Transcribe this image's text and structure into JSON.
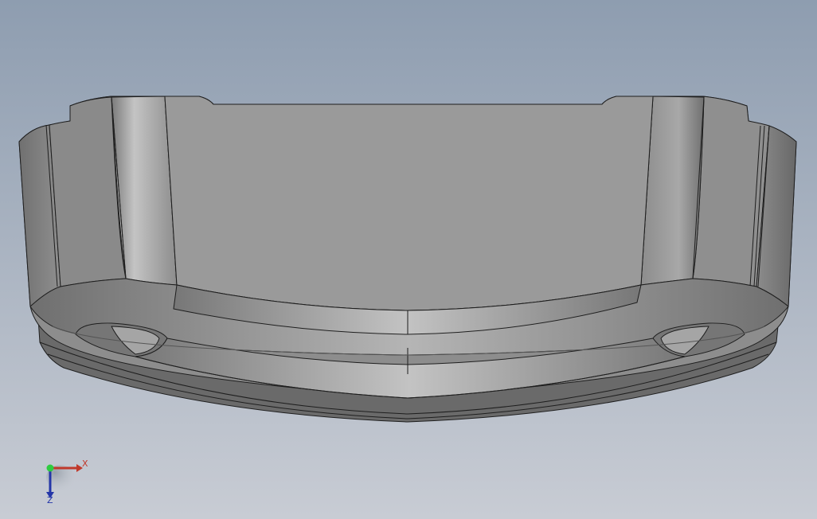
{
  "viewport": {
    "background_top": "#8e9db0",
    "background_bottom": "#c8ccd4",
    "model_colors": {
      "light": "#b9b9b9",
      "mid": "#9a9a9a",
      "dark": "#6f6f6f",
      "edge": "#1e1e1e"
    }
  },
  "triad": {
    "x_label": "X",
    "z_label": "Z",
    "x_color": "#c0392b",
    "y_color": "#2ecc40",
    "z_color": "#2436a8"
  }
}
